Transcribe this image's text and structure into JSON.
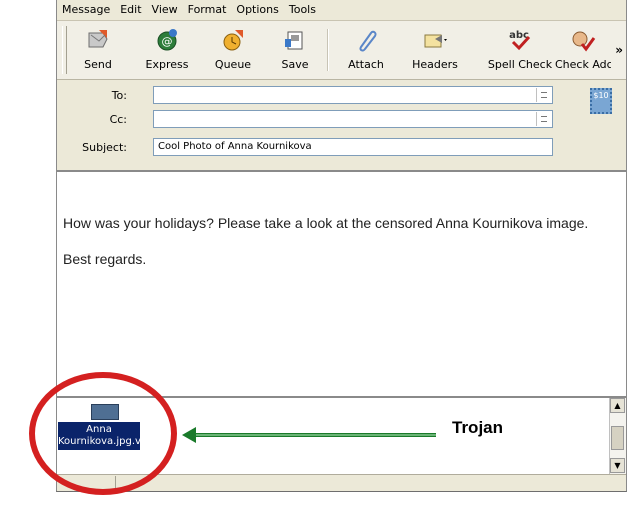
{
  "menu": [
    "Message",
    "Edit",
    "View",
    "Format",
    "Options",
    "Tools"
  ],
  "toolbar": {
    "buttons": [
      {
        "label": "Send",
        "icon": "send-icon"
      },
      {
        "label": "Express",
        "icon": "express-icon"
      },
      {
        "label": "Queue",
        "icon": "queue-icon"
      },
      {
        "label": "Save",
        "icon": "save-icon"
      },
      {
        "label": "Attach",
        "icon": "paperclip-icon"
      },
      {
        "label": "Headers",
        "icon": "headers-icon"
      },
      {
        "label": "Spell Check",
        "icon": "spell-check-icon"
      },
      {
        "label": "Check Adc",
        "icon": "check-address-icon"
      }
    ],
    "overflow": "»"
  },
  "header": {
    "to_label": "To:",
    "cc_label": "Cc:",
    "subject_label": "Subject:",
    "to_value": "",
    "cc_value": "",
    "subject_value": "Cool Photo of Anna Kournikova",
    "stamp_text": "$10"
  },
  "body": {
    "line1": "How was your holidays? Please take a look at the censored Anna Kournikova image.",
    "line2": "Best regards."
  },
  "attachment": {
    "name": "Anna Kournikova.jpg.vbs"
  },
  "annotation": {
    "label": "Trojan",
    "ring_color": "#d42020",
    "arrow_color": "#1a7a2a"
  }
}
